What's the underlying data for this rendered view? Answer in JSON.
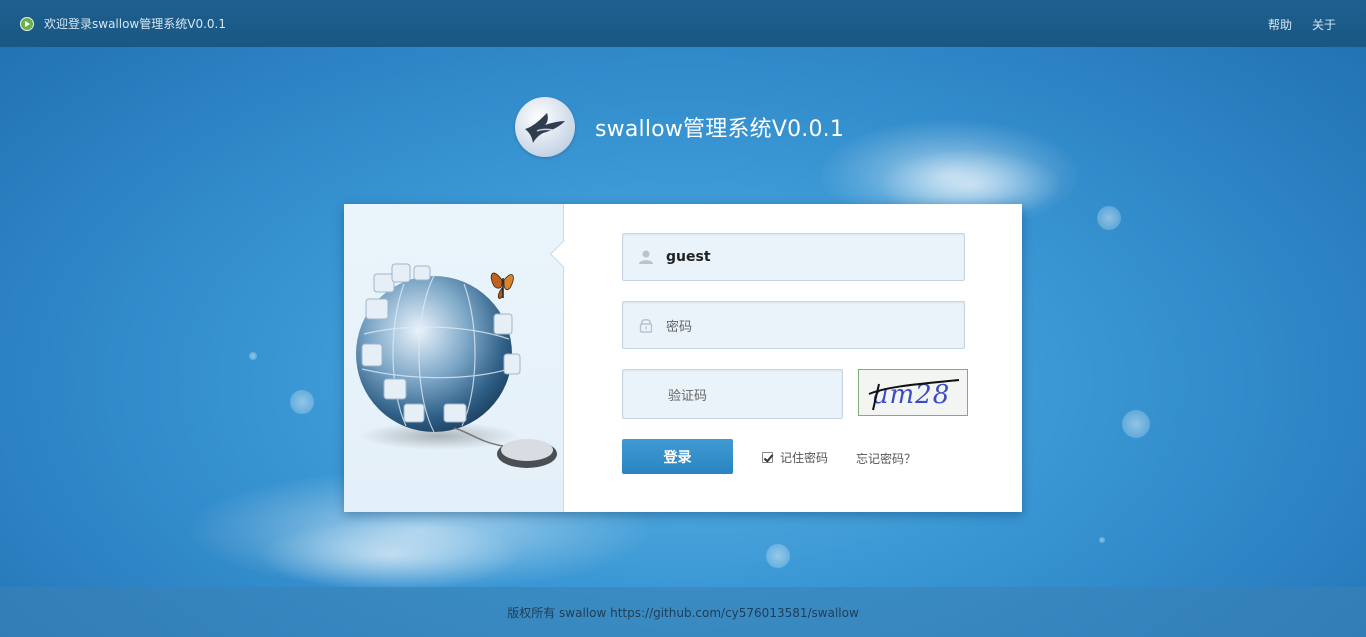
{
  "topbar": {
    "welcome": "欢迎登录swallow管理系统V0.0.1",
    "links": [
      "帮助",
      "关于"
    ]
  },
  "brand": {
    "title": "swallow管理系统V0.0.1"
  },
  "login": {
    "username_value": "guest",
    "password_placeholder": "密码",
    "captcha_placeholder": "验证码",
    "captcha_text": "am28",
    "login_button": "登录",
    "remember_label": "记住密码",
    "remember_checked": true,
    "forgot_label": "忘记密码？"
  },
  "footer": {
    "copyright": "版权所有 swallow https://github.com/cy576013581/swallow"
  },
  "colors": {
    "accent": "#2b84c0",
    "topbar": "#1a5883"
  }
}
